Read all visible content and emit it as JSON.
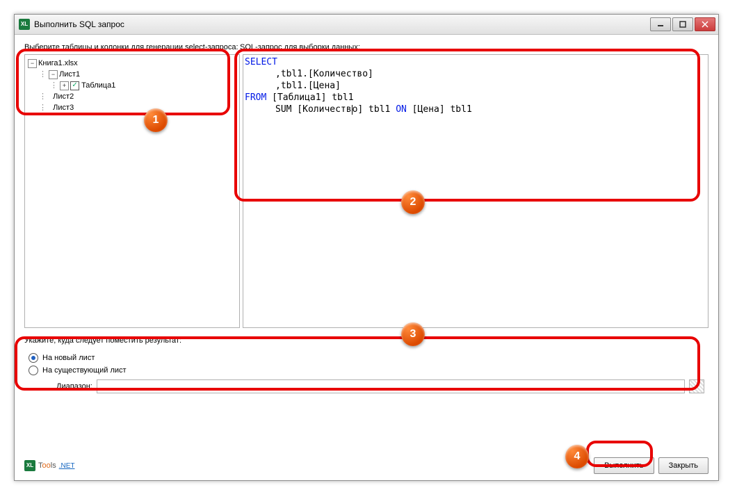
{
  "window": {
    "title": "Выполнить SQL запрос"
  },
  "labels": {
    "tree": "Выберите таблицы и колонки для генерации select-запроса:",
    "sql": "SQL-запрос для выборки данных:",
    "output": "Укажите, куда следует поместить результат:",
    "range": "Диапазон:"
  },
  "tree": {
    "root": "Книга1.xlsx",
    "sheet1": "Лист1",
    "table1": "Таблица1",
    "sheet2": "Лист2",
    "sheet3": "Лист3"
  },
  "sql": {
    "kw_select": "SELECT",
    "line2": ",tbl1.[Количество]",
    "line3": ",tbl1.[Цена]",
    "kw_from": "FROM",
    "from_rest": " [Таблица1] tbl1",
    "line5a": "SUM [Количеств",
    "line5b": "о] tbl1 ",
    "kw_on": "ON",
    "line5c": " [Цена] tbl1"
  },
  "output": {
    "opt_new": "На новый лист",
    "opt_exist": "На существующий лист"
  },
  "buttons": {
    "run": "Выполнить",
    "close": "Закрыть"
  },
  "logo": {
    "icon": "XL",
    "brand_pre": "T",
    "brand_mid": "oo",
    "brand_post": "ls",
    "net": ".NET"
  },
  "callouts": {
    "c1": "1",
    "c2": "2",
    "c3": "3",
    "c4": "4"
  }
}
